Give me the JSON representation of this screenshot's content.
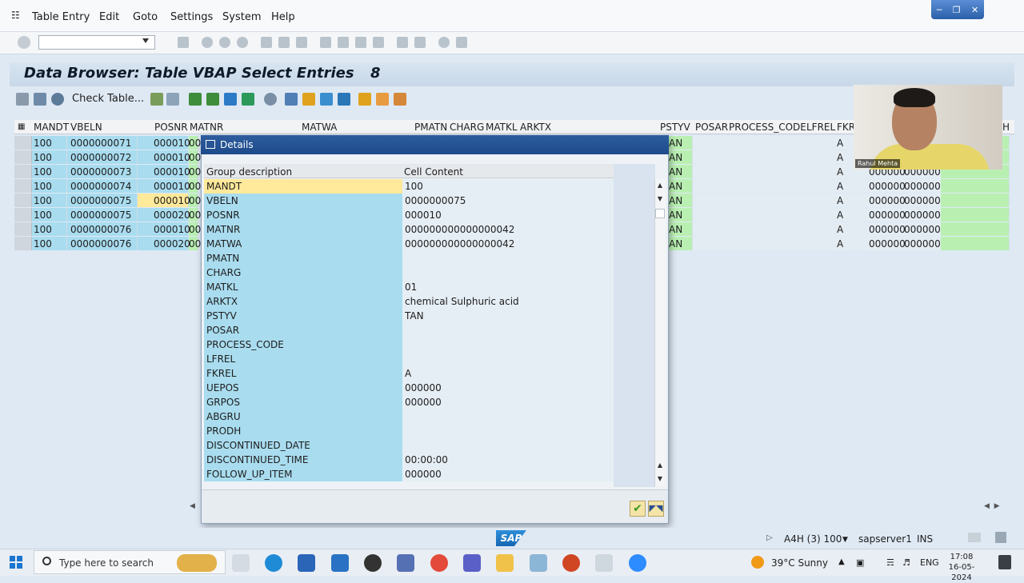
{
  "menu": [
    "Table Entry",
    "Edit",
    "Goto",
    "Settings",
    "System",
    "Help"
  ],
  "title": "Data Browser: Table VBAP Select Entries",
  "title_count": "8",
  "toolbar2": {
    "check_table": "Check Table..."
  },
  "grid": {
    "columns": [
      "MANDT",
      "VBELN",
      "POSNR",
      "MATNR",
      "MATWA",
      "PMATN",
      "CHARG",
      "MATKL",
      "ARKTX",
      "PSTYV",
      "POSAR",
      "PROCESS_CODE",
      "LFREL",
      "FKR",
      "H"
    ],
    "rows": [
      {
        "mandt": "100",
        "vbeln": "0000000071",
        "posnr": "000010",
        "matnr": "00",
        "pstyv": "AN",
        "fkrel": "A",
        "uepos": "",
        "grpos": ""
      },
      {
        "mandt": "100",
        "vbeln": "0000000072",
        "posnr": "000010",
        "matnr": "00",
        "pstyv": "AN",
        "fkrel": "A",
        "uepos": "",
        "grpos": ""
      },
      {
        "mandt": "100",
        "vbeln": "0000000073",
        "posnr": "000010",
        "matnr": "00",
        "pstyv": "AN",
        "fkrel": "A",
        "uepos": "000000",
        "grpos": "000000"
      },
      {
        "mandt": "100",
        "vbeln": "0000000074",
        "posnr": "000010",
        "matnr": "00",
        "pstyv": "AN",
        "fkrel": "A",
        "uepos": "000000",
        "grpos": "000000"
      },
      {
        "mandt": "100",
        "vbeln": "0000000075",
        "posnr": "000010",
        "matnr": "00",
        "pstyv": "AN",
        "fkrel": "A",
        "uepos": "000000",
        "grpos": "000000"
      },
      {
        "mandt": "100",
        "vbeln": "0000000075",
        "posnr": "000020",
        "matnr": "00",
        "pstyv": "AN",
        "fkrel": "A",
        "uepos": "000000",
        "grpos": "000000"
      },
      {
        "mandt": "100",
        "vbeln": "0000000076",
        "posnr": "000010",
        "matnr": "00",
        "pstyv": "AN",
        "fkrel": "A",
        "uepos": "000000",
        "grpos": "000000"
      },
      {
        "mandt": "100",
        "vbeln": "0000000076",
        "posnr": "000020",
        "matnr": "00",
        "pstyv": "AN",
        "fkrel": "A",
        "uepos": "000000",
        "grpos": "000000"
      }
    ]
  },
  "webcam": {
    "name": "Rahul Mehta"
  },
  "dialog": {
    "title": "Details",
    "col_group": "Group description",
    "col_content": "Cell Content",
    "rows": [
      {
        "g": "MANDT",
        "v": "100"
      },
      {
        "g": "VBELN",
        "v": "0000000075"
      },
      {
        "g": "POSNR",
        "v": "000010"
      },
      {
        "g": "MATNR",
        "v": "000000000000000042"
      },
      {
        "g": "MATWA",
        "v": "000000000000000042"
      },
      {
        "g": "PMATN",
        "v": ""
      },
      {
        "g": "CHARG",
        "v": ""
      },
      {
        "g": "MATKL",
        "v": "01"
      },
      {
        "g": "ARKTX",
        "v": "chemical Sulphuric acid"
      },
      {
        "g": "PSTYV",
        "v": "TAN"
      },
      {
        "g": "POSAR",
        "v": ""
      },
      {
        "g": "PROCESS_CODE",
        "v": ""
      },
      {
        "g": "LFREL",
        "v": ""
      },
      {
        "g": "FKREL",
        "v": "A"
      },
      {
        "g": "UEPOS",
        "v": "000000"
      },
      {
        "g": "GRPOS",
        "v": "000000"
      },
      {
        "g": "ABGRU",
        "v": ""
      },
      {
        "g": "PRODH",
        "v": ""
      },
      {
        "g": "DISCONTINUED_DATE",
        "v": ""
      },
      {
        "g": "DISCONTINUED_TIME",
        "v": "00:00:00"
      },
      {
        "g": "FOLLOW_UP_ITEM",
        "v": "000000"
      }
    ]
  },
  "status": {
    "system": "A4H (3) 100",
    "server": "sapserver1",
    "mode": "INS"
  },
  "taskbar": {
    "search_placeholder": "Type here to search",
    "weather": "39°C  Sunny",
    "lang": "ENG",
    "time": "17:08",
    "date": "16-05-2024"
  },
  "colors": {
    "cyan": "#a9dcef",
    "green": "#b9f0b2",
    "yellow": "#ffe99a",
    "title": "#1d4a8a"
  }
}
